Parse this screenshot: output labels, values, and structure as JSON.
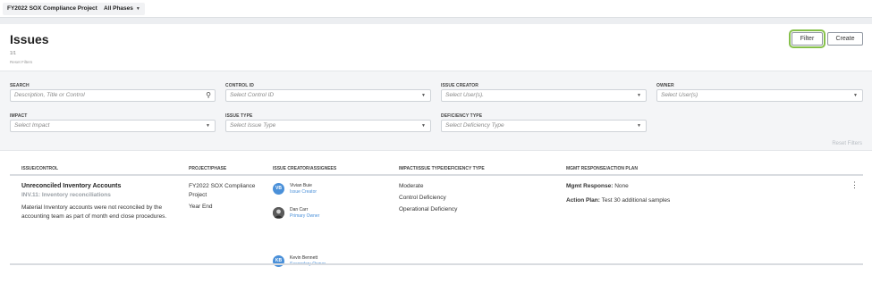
{
  "topbar": {
    "project": "FY2022 SOX Compliance Project",
    "phase": "All Phases"
  },
  "page": {
    "title": "Issues",
    "count": "1/1",
    "reset_small": "Reset Filters"
  },
  "actions": {
    "filter": "Filter",
    "create": "Create"
  },
  "filters": {
    "search": {
      "label": "SEARCH",
      "placeholder": "Description, Title or Control"
    },
    "control_id": {
      "label": "CONTROL ID",
      "placeholder": "Select Control ID"
    },
    "issue_creator": {
      "label": "ISSUE CREATOR",
      "placeholder": "Select User(s)."
    },
    "owner": {
      "label": "OWNER",
      "placeholder": "Select User(s)"
    },
    "impact": {
      "label": "IMPACT",
      "placeholder": "Select Impact"
    },
    "issue_type": {
      "label": "ISSUE TYPE",
      "placeholder": "Select Issue Type"
    },
    "deficiency_type": {
      "label": "DEFICIENCY TYPE",
      "placeholder": "Select Deficiency Type"
    },
    "reset": "Reset Filters"
  },
  "table": {
    "headers": [
      "ISSUE/CONTROL",
      "PROJECT/PHASE",
      "ISSUE CREATOR/ASSIGNEES",
      "IMPACT/ISSUE TYPE/DEFICIENCY TYPE",
      "MGMT RESPONSE/ACTION PLAN"
    ],
    "row": {
      "title": "Unreconciled Inventory Accounts",
      "control": "INV.11: Inventory reconciliations",
      "description": "Material Inventory accounts were not reconciled by the accounting team as part of month end close procedures.",
      "project": "FY2022 SOX Compliance Project",
      "phase": "Year End",
      "people": [
        {
          "initials": "VB",
          "name": "Vivian Buie",
          "role": "Issue Creator"
        },
        {
          "initials": "",
          "name": "Dan Carr",
          "role": "Primary Owner"
        },
        {
          "initials": "KB",
          "name": "Kevin Bennett",
          "role": "Secondary Owner"
        }
      ],
      "impact": "Moderate",
      "issue_type": "Control Deficiency",
      "deficiency_type": "Operational Deficiency",
      "mgmt_label": "Mgmt Response:",
      "mgmt_value": "None",
      "plan_label": "Action Plan:",
      "plan_value": "Test 30 additional samples"
    }
  }
}
